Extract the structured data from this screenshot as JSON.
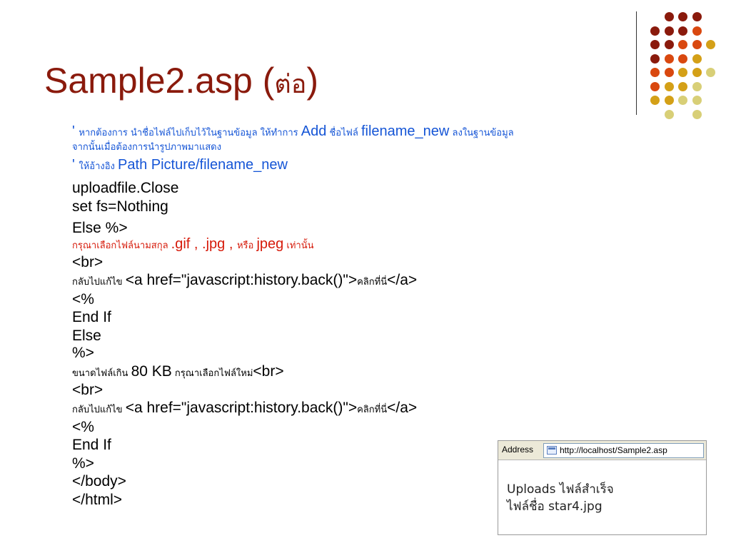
{
  "title": {
    "main": "Sample2.asp (",
    "thai": "ต่อ",
    "close": ")"
  },
  "code": {
    "c1_a": "' ",
    "c1_b": "หากต้องการ นำชื่อไฟล์ไปเก็บไว้ในฐานข้อมูล ให้ทำการ ",
    "c1_c": "Add",
    "c1_d": " ชื่อไฟล์ ",
    "c1_e": "filename_new",
    "c1_f": " ลงในฐานข้อมูล",
    "c2": "จากนั้นเมื่อต้องการนำรูปภาพมาแสดง",
    "c3_a": "' ",
    "c3_b": "ให้อ้างอิง ",
    "c3_c": "Path Picture/filename_new",
    "l_close": "uploadfile.Close",
    "l_setfs": "set fs=Nothing",
    "l_else1": "Else %>",
    "m1_a": "กรุณาเลือกไฟล์นามสกุล ",
    "m1_b": ".gif , .jpg , ",
    "m1_c": "หรือ ",
    "m1_d": "jpeg",
    "m1_e": " เท่านั้น",
    "l_br1": "<br>",
    "back1_a": "กลับไปแก้ไข ",
    "back1_b": "<a href=\"javascript:history.back()\">",
    "back1_c": "คลิกที่นี่",
    "back1_d": "</a>",
    "l_open1": "<%",
    "l_endif1": "End If",
    "l_else2": "Else",
    "l_close1": "%>",
    "size_a": "ขนาดไฟล์เกิน ",
    "size_b": "80 KB",
    "size_c": " กรุณาเลือกไฟล์ใหม่",
    "size_d": "<br>",
    "l_br2": "<br>",
    "back2_a": "กลับไปแก้ไข ",
    "back2_b": "<a href=\"javascript:history.back()\">",
    "back2_c": "คลิกที่นี่",
    "back2_d": "</a>",
    "l_open2": "<%",
    "l_endif2": "End If",
    "l_close2": "%>",
    "l_body": "</body>",
    "l_html": "</html>"
  },
  "browser": {
    "address_label": "Address",
    "url": "http://localhost/Sample2.asp",
    "line1": "Uploads ไฟล์สำเร็จ",
    "line2": "ไฟล์ชื่อ star4.jpg"
  },
  "decoration": {
    "colors": {
      "dark_red": "#8a1a0c",
      "orange": "#d9480f",
      "gold": "#d4a017",
      "khaki": "#d8cf77"
    }
  }
}
